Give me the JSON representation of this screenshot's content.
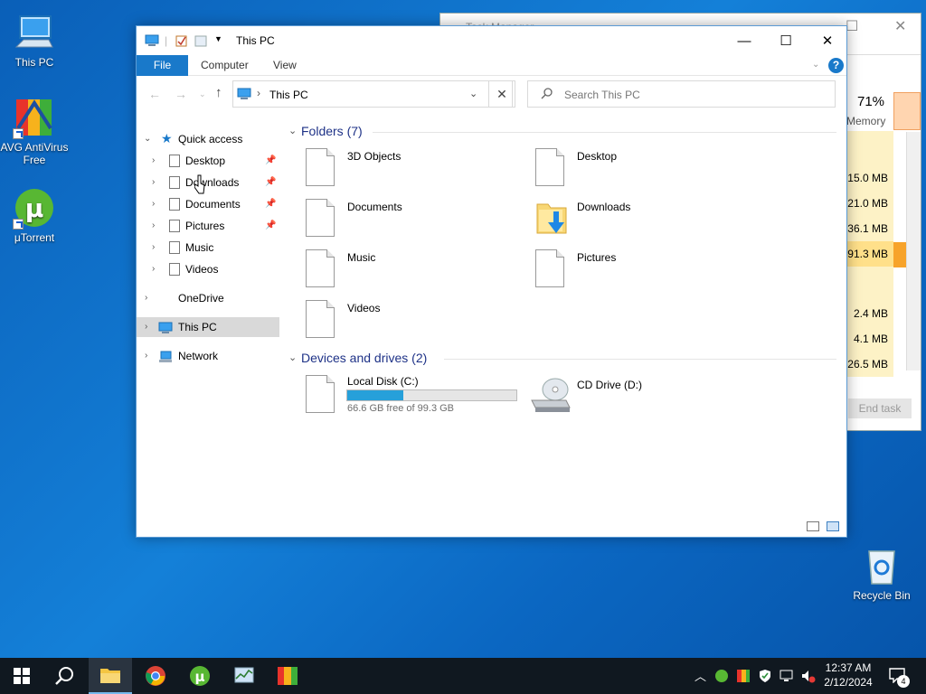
{
  "desktop": {
    "icons": [
      {
        "label": "This PC"
      },
      {
        "label": "AVG AntiVirus Free"
      },
      {
        "label": "μTorrent"
      },
      {
        "label": "Recycle Bin"
      }
    ]
  },
  "taskmgr": {
    "title": "Task Manager",
    "memory_pct": "71%",
    "memory_label": "Memory",
    "values": [
      "15.0 MB",
      "21.0 MB",
      "36.1 MB",
      "91.3 MB",
      "2.4 MB",
      "4.1 MB",
      "26.5 MB"
    ],
    "end_task": "End task"
  },
  "explorer": {
    "title": "This PC",
    "ribbon": {
      "file": "File",
      "computer": "Computer",
      "view": "View",
      "help": "?"
    },
    "address": "This PC",
    "search_placeholder": "Search This PC",
    "nav": {
      "quick_access": "Quick access",
      "desktop": "Desktop",
      "downloads": "Downloads",
      "documents": "Documents",
      "pictures": "Pictures",
      "music": "Music",
      "videos": "Videos",
      "onedrive": "OneDrive",
      "this_pc": "This PC",
      "network": "Network"
    },
    "folders_header": "Folders (7)",
    "folders": [
      "3D Objects",
      "Desktop",
      "Documents",
      "Downloads",
      "Music",
      "Pictures",
      "Videos"
    ],
    "drives_header": "Devices and drives (2)",
    "drives": {
      "c_name": "Local Disk (C:)",
      "c_free": "66.6 GB free of 99.3 GB",
      "c_used_fraction": 0.33,
      "d_name": "CD Drive (D:)"
    }
  },
  "taskbar": {
    "time": "12:37 AM",
    "date": "2/12/2024",
    "notifications": "4"
  },
  "colors": {
    "accent": "#1979ca",
    "selection": "#d9d9d9",
    "progress": "#26a0da"
  }
}
